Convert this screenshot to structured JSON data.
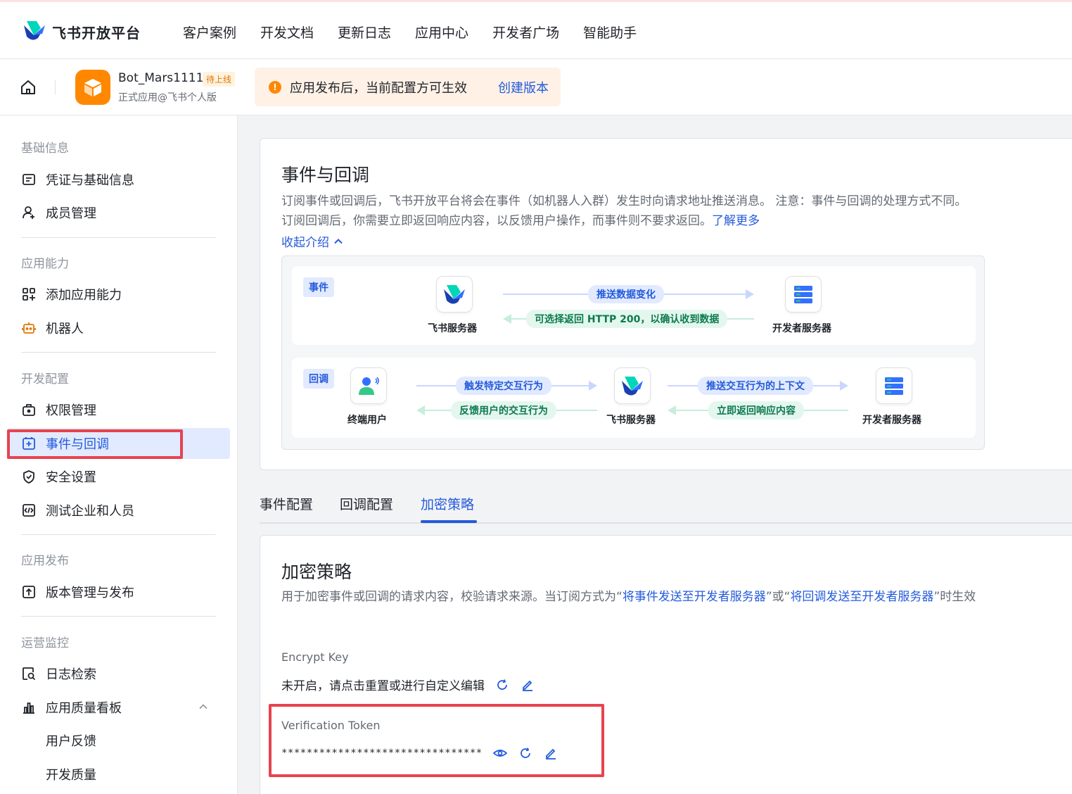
{
  "brand": {
    "name": "飞书开放平台",
    "logo_icon": "feishu-logo-icon"
  },
  "nav": [
    "客户案例",
    "开发文档",
    "更新日志",
    "应用中心",
    "开发者广场",
    "智能助手"
  ],
  "app": {
    "name": "Bot_Mars1111",
    "status_badge": "待上线",
    "subtitle": "正式应用@飞书个人版",
    "notice_text": "应用发布后，当前配置方可生效",
    "notice_link": "创建版本"
  },
  "sidebar": {
    "groups": {
      "basic": "基础信息",
      "capability": "应用能力",
      "dev": "开发配置",
      "release": "应用发布",
      "ops": "运营监控"
    },
    "items": {
      "credentials": "凭证与基础信息",
      "members": "成员管理",
      "add_capability": "添加应用能力",
      "bot": "机器人",
      "permissions": "权限管理",
      "events": "事件与回调",
      "security": "安全设置",
      "test_tenant": "测试企业和人员",
      "versions": "版本管理与发布",
      "log_search": "日志检索",
      "quality_board": "应用质量看板",
      "user_feedback": "用户反馈",
      "dev_quality": "开发质量"
    }
  },
  "intro": {
    "title": "事件与回调",
    "desc_1": "订阅事件或回调后，飞书开放平台将会在事件（如机器人入群）发生时向请求地址推送消息。 注意：事件与回调的处理方式不同。订阅回调后，你需要立即返回响应内容，以反馈用户操作，而事件则不要求返回。",
    "desc_link": "了解更多",
    "collapse": "收起介绍"
  },
  "diagram": {
    "event": {
      "tag": "事件",
      "source": "飞书服务器",
      "target": "开发者服务器",
      "push": "推送数据变化",
      "reply": "可选择返回 HTTP 200，以确认收到数据"
    },
    "callback": {
      "tag": "回调",
      "user": "终端用户",
      "server": "飞书服务器",
      "target": "开发者服务器",
      "trigger": "触发特定交互行为",
      "feedback": "反馈用户的交互行为",
      "push_ctx": "推送交互行为的上下文",
      "respond": "立即返回响应内容"
    }
  },
  "tabs": [
    "事件配置",
    "回调配置",
    "加密策略"
  ],
  "encryption": {
    "title": "加密策略",
    "desc_prefix": "用于加密事件或回调的请求内容，校验请求来源。当订阅方式为“",
    "desc_link1": "将事件发送至开发者服务器",
    "desc_mid": "”或“",
    "desc_link2": "将回调发送至开发者服务器",
    "desc_suffix": "”时生效",
    "encrypt_key_label": "Encrypt Key",
    "encrypt_key_value": "未开启，请点击重置或进行自定义编辑",
    "token_label": "Verification Token",
    "token_value": "********************************"
  },
  "colors": {
    "accent": "#245bdb",
    "highlight_border": "#e8424f",
    "app_icon_bg": "#ff8800"
  }
}
